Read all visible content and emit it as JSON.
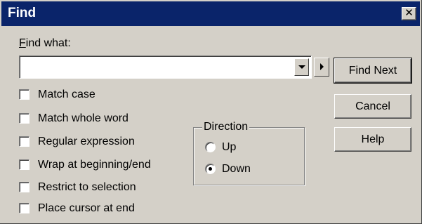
{
  "window": {
    "title": "Find",
    "close_glyph": "✕"
  },
  "find": {
    "label": "Find what:",
    "value": "",
    "placeholder": ""
  },
  "buttons": {
    "find_next": "Find Next",
    "cancel": "Cancel",
    "help": "Help"
  },
  "options": [
    {
      "label": "Match case",
      "checked": false
    },
    {
      "label": "Match whole word",
      "checked": false
    },
    {
      "label": "Regular expression",
      "checked": false
    },
    {
      "label": "Wrap at beginning/end",
      "checked": false
    },
    {
      "label": "Restrict to selection",
      "checked": false
    },
    {
      "label": "Place cursor at end",
      "checked": false
    }
  ],
  "direction": {
    "legend": "Direction",
    "options": [
      {
        "label": "Up",
        "selected": false
      },
      {
        "label": "Down",
        "selected": true
      }
    ]
  },
  "colors": {
    "titlebar": "#0a246a",
    "face": "#d4d0c8"
  },
  "icons": {
    "dropdown": "chevron-down-icon",
    "expand": "arrow-right-icon",
    "close": "close-icon"
  }
}
